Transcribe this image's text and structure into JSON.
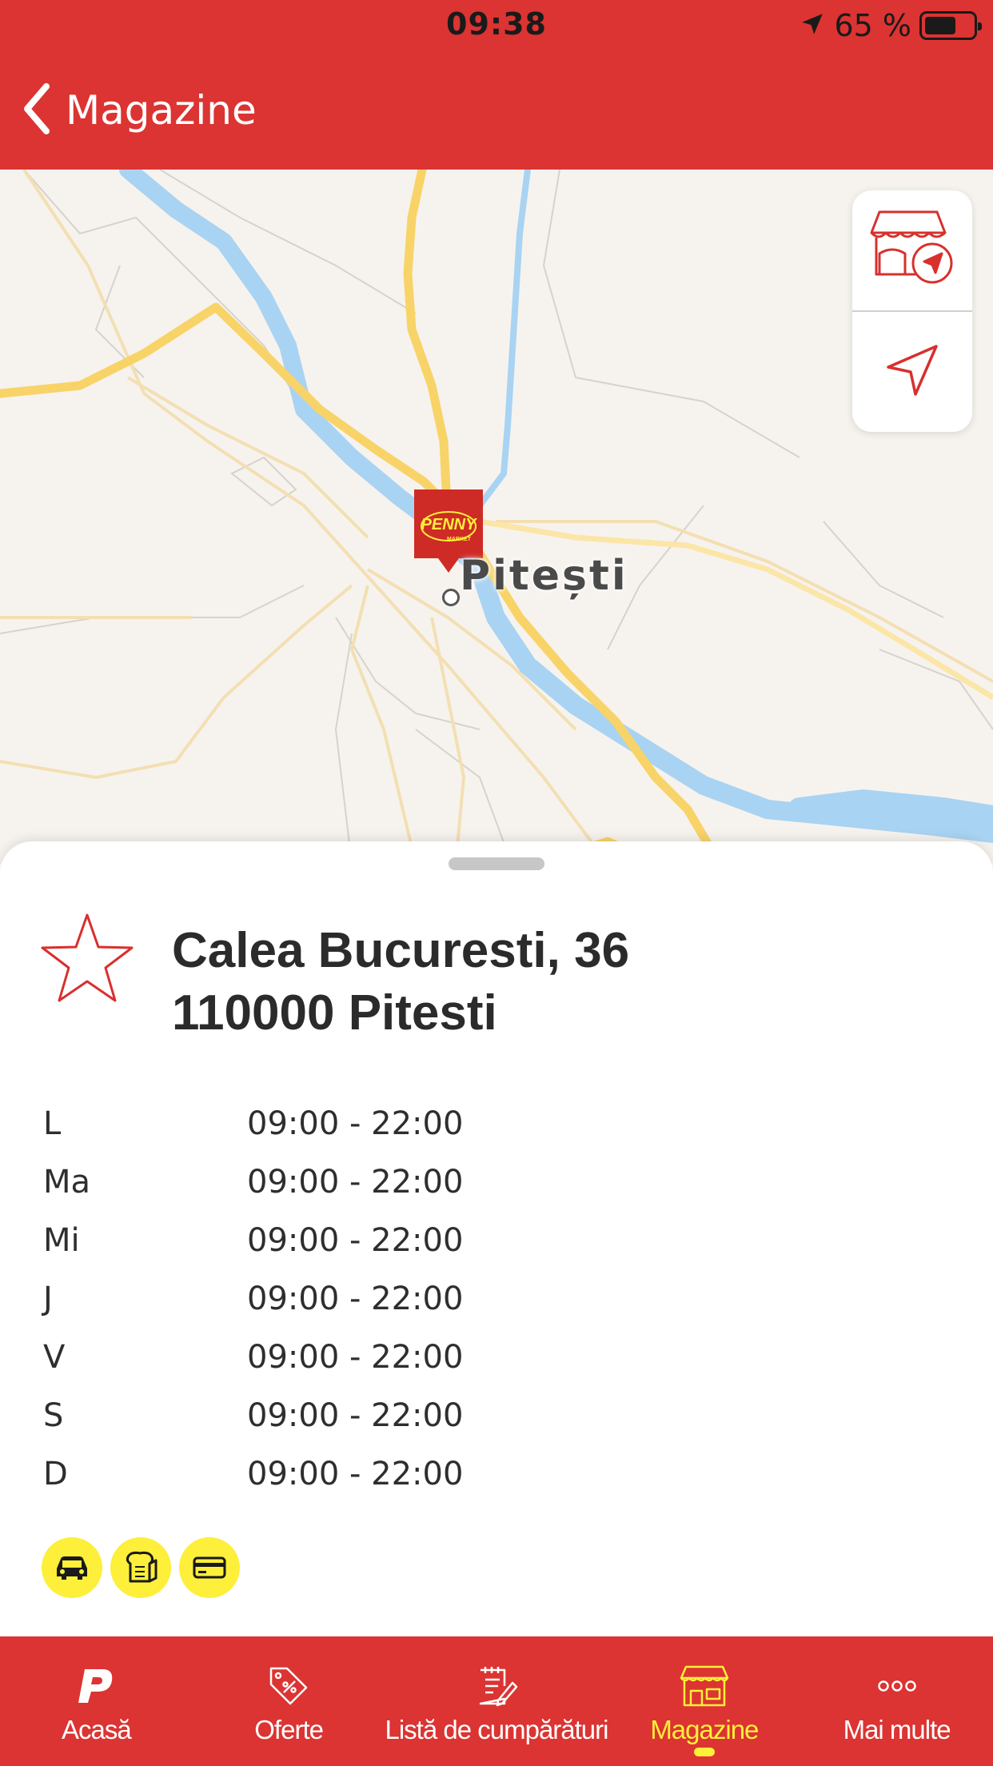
{
  "status_bar": {
    "time": "09:38",
    "battery_text": "65 %",
    "battery_level": 0.65,
    "icons": [
      "location-arrow-icon",
      "battery-icon"
    ]
  },
  "nav": {
    "back_label": "Magazine",
    "back_icon": "chevron-left-icon"
  },
  "map": {
    "city_label": "Pitești",
    "pin_brand": "PENNY",
    "pin_sub": "MARKET",
    "controls": [
      "store-locate-icon",
      "navigation-arrow-icon"
    ]
  },
  "store": {
    "address_line1": "Calea Bucuresti, 36",
    "address_line2": "110000 Pitesti",
    "favorite_icon": "star-outline-icon",
    "hours": [
      {
        "day": "L",
        "time": "09:00 - 22:00"
      },
      {
        "day": "Ma",
        "time": "09:00 - 22:00"
      },
      {
        "day": "Mi",
        "time": "09:00 - 22:00"
      },
      {
        "day": "J",
        "time": "09:00 - 22:00"
      },
      {
        "day": "V",
        "time": "09:00 - 22:00"
      },
      {
        "day": "S",
        "time": "09:00 - 22:00"
      },
      {
        "day": "D",
        "time": "09:00 - 22:00"
      }
    ],
    "features": [
      "parking-car-icon",
      "bakery-bread-icon",
      "card-payment-icon"
    ]
  },
  "tabs": [
    {
      "label": "Acasă",
      "icon": "penny-p-icon",
      "active": false
    },
    {
      "label": "Oferte",
      "icon": "tag-percent-icon",
      "active": false
    },
    {
      "label": "Listă de cumpărături",
      "icon": "shopping-list-icon",
      "active": false
    },
    {
      "label": "Magazine",
      "icon": "store-icon",
      "active": true
    },
    {
      "label": "Mai multe",
      "icon": "more-dots-icon",
      "active": false
    }
  ],
  "colors": {
    "brand_red": "#db3432",
    "accent_yellow": "#fdef3a",
    "map_water": "#a9d3f2",
    "map_road": "#f8d368"
  }
}
